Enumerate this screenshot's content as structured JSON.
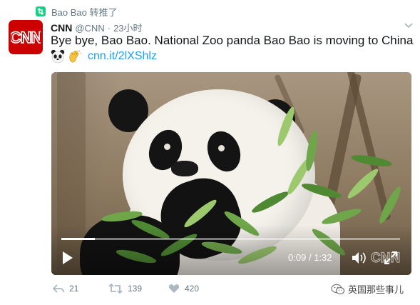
{
  "retweet": {
    "label": "Bao Bao 转推了",
    "icon": "retweet-badge-icon",
    "color": "#19cf86"
  },
  "tweet": {
    "author_name": "CNN",
    "author_handle": "@CNN",
    "separator": "·",
    "time": "23小时",
    "avatar_label": "CNN",
    "text": "Bye bye, Bao Bao. National Zoo panda Bao Bao is moving to China",
    "emojis": [
      "panda-face-icon",
      "waving-hand-icon"
    ],
    "link": "cnn.it/2lXShlz",
    "link_color": "#1da1f2"
  },
  "video": {
    "current_time": "0:09",
    "time_separator": "/",
    "duration": "1:32",
    "progress_fraction": 0.098,
    "watermark": "CNN"
  },
  "actions": {
    "reply_count": "21",
    "retweet_count": "139",
    "like_count": "420"
  },
  "source": {
    "label": "英国那些事儿",
    "icon": "wechat-icon"
  }
}
